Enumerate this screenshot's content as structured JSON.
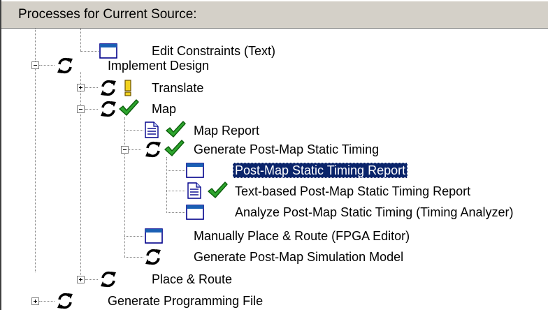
{
  "panel": {
    "header_label": "Processes for Current Source:"
  },
  "tree": {
    "items": [
      {
        "label": "Edit Constraints (Text)",
        "icon": "window-icon",
        "expander": "none"
      },
      {
        "label": "Implement Design",
        "icon": "process-sync-icon",
        "expander": "expanded"
      },
      {
        "label": "Translate",
        "icon": "process-sync-icon",
        "status": "warning-icon",
        "expander": "collapsed"
      },
      {
        "label": "Map",
        "icon": "process-sync-icon",
        "status": "check-icon",
        "expander": "expanded"
      },
      {
        "label": "Map Report",
        "icon": "document-icon",
        "status": "check-icon",
        "expander": "none"
      },
      {
        "label": "Generate Post-Map Static Timing",
        "icon": "process-sync-icon",
        "status": "check-icon",
        "expander": "expanded"
      },
      {
        "label": "Post-Map Static Timing Report",
        "icon": "window-icon",
        "expander": "none",
        "selected": true
      },
      {
        "label": "Text-based Post-Map Static Timing Report",
        "icon": "document-icon",
        "status": "check-icon",
        "expander": "none"
      },
      {
        "label": "Analyze Post-Map Static Timing (Timing Analyzer)",
        "icon": "window-icon",
        "expander": "none"
      },
      {
        "label": "Manually Place & Route (FPGA Editor)",
        "icon": "window-icon",
        "expander": "none"
      },
      {
        "label": "Generate Post-Map Simulation Model",
        "icon": "process-sync-icon",
        "expander": "none"
      },
      {
        "label": "Place & Route",
        "icon": "process-sync-icon",
        "expander": "collapsed"
      },
      {
        "label": "Generate Programming File",
        "icon": "process-sync-icon",
        "expander": "collapsed"
      }
    ]
  },
  "colors": {
    "selection_bg": "#0a246a",
    "check_green": "#2ea52e",
    "warning_yellow": "#f2d21e"
  }
}
